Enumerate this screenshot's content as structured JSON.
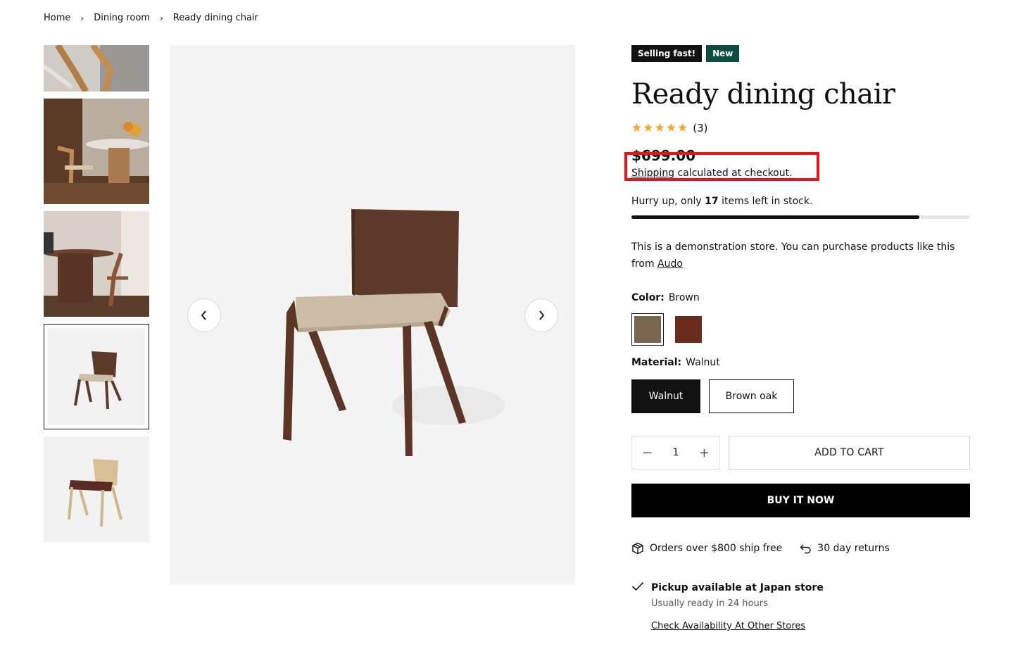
{
  "breadcrumb": {
    "items": [
      "Home",
      "Dining room",
      "Ready dining chair"
    ]
  },
  "product": {
    "badges": [
      "Selling fast!",
      "New"
    ],
    "title": "Ready dining chair",
    "rating_count": "(3)",
    "rating_stars": 5,
    "price": "$699.00",
    "shipping_link": "Shipping",
    "shipping_text": "calculated at checkout.",
    "stock_prefix": "Hurry up, only",
    "stock_count": "17",
    "stock_suffix": "items left in stock.",
    "stock_level": 0.85,
    "description_text": "This is a demonstration store. You can purchase products like this from",
    "description_link": "Audo"
  },
  "options": {
    "color_label": "Color:",
    "color_value": "Brown",
    "color_swatches": [
      {
        "name": "Brown",
        "hex": "#7a6550"
      },
      {
        "name": "Red",
        "hex": "#6a2a1c"
      }
    ],
    "material_label": "Material:",
    "material_value": "Walnut",
    "materials": [
      "Walnut",
      "Brown oak"
    ]
  },
  "cart": {
    "quantity": "1",
    "minus": "−",
    "plus": "+",
    "add_to_cart": "ADD TO CART",
    "buy_now": "BUY IT NOW"
  },
  "perks": {
    "shipping": "Orders over $800 ship free",
    "returns": "30 day returns"
  },
  "pickup": {
    "title": "Pickup available at Japan store",
    "subtitle": "Usually ready in 24 hours",
    "link": "Check Availability At Other Stores"
  },
  "colors": {
    "accent": "#111111",
    "badge_green": "#0c4d3e",
    "star": "#f5a623",
    "highlight": "#e8141b"
  }
}
